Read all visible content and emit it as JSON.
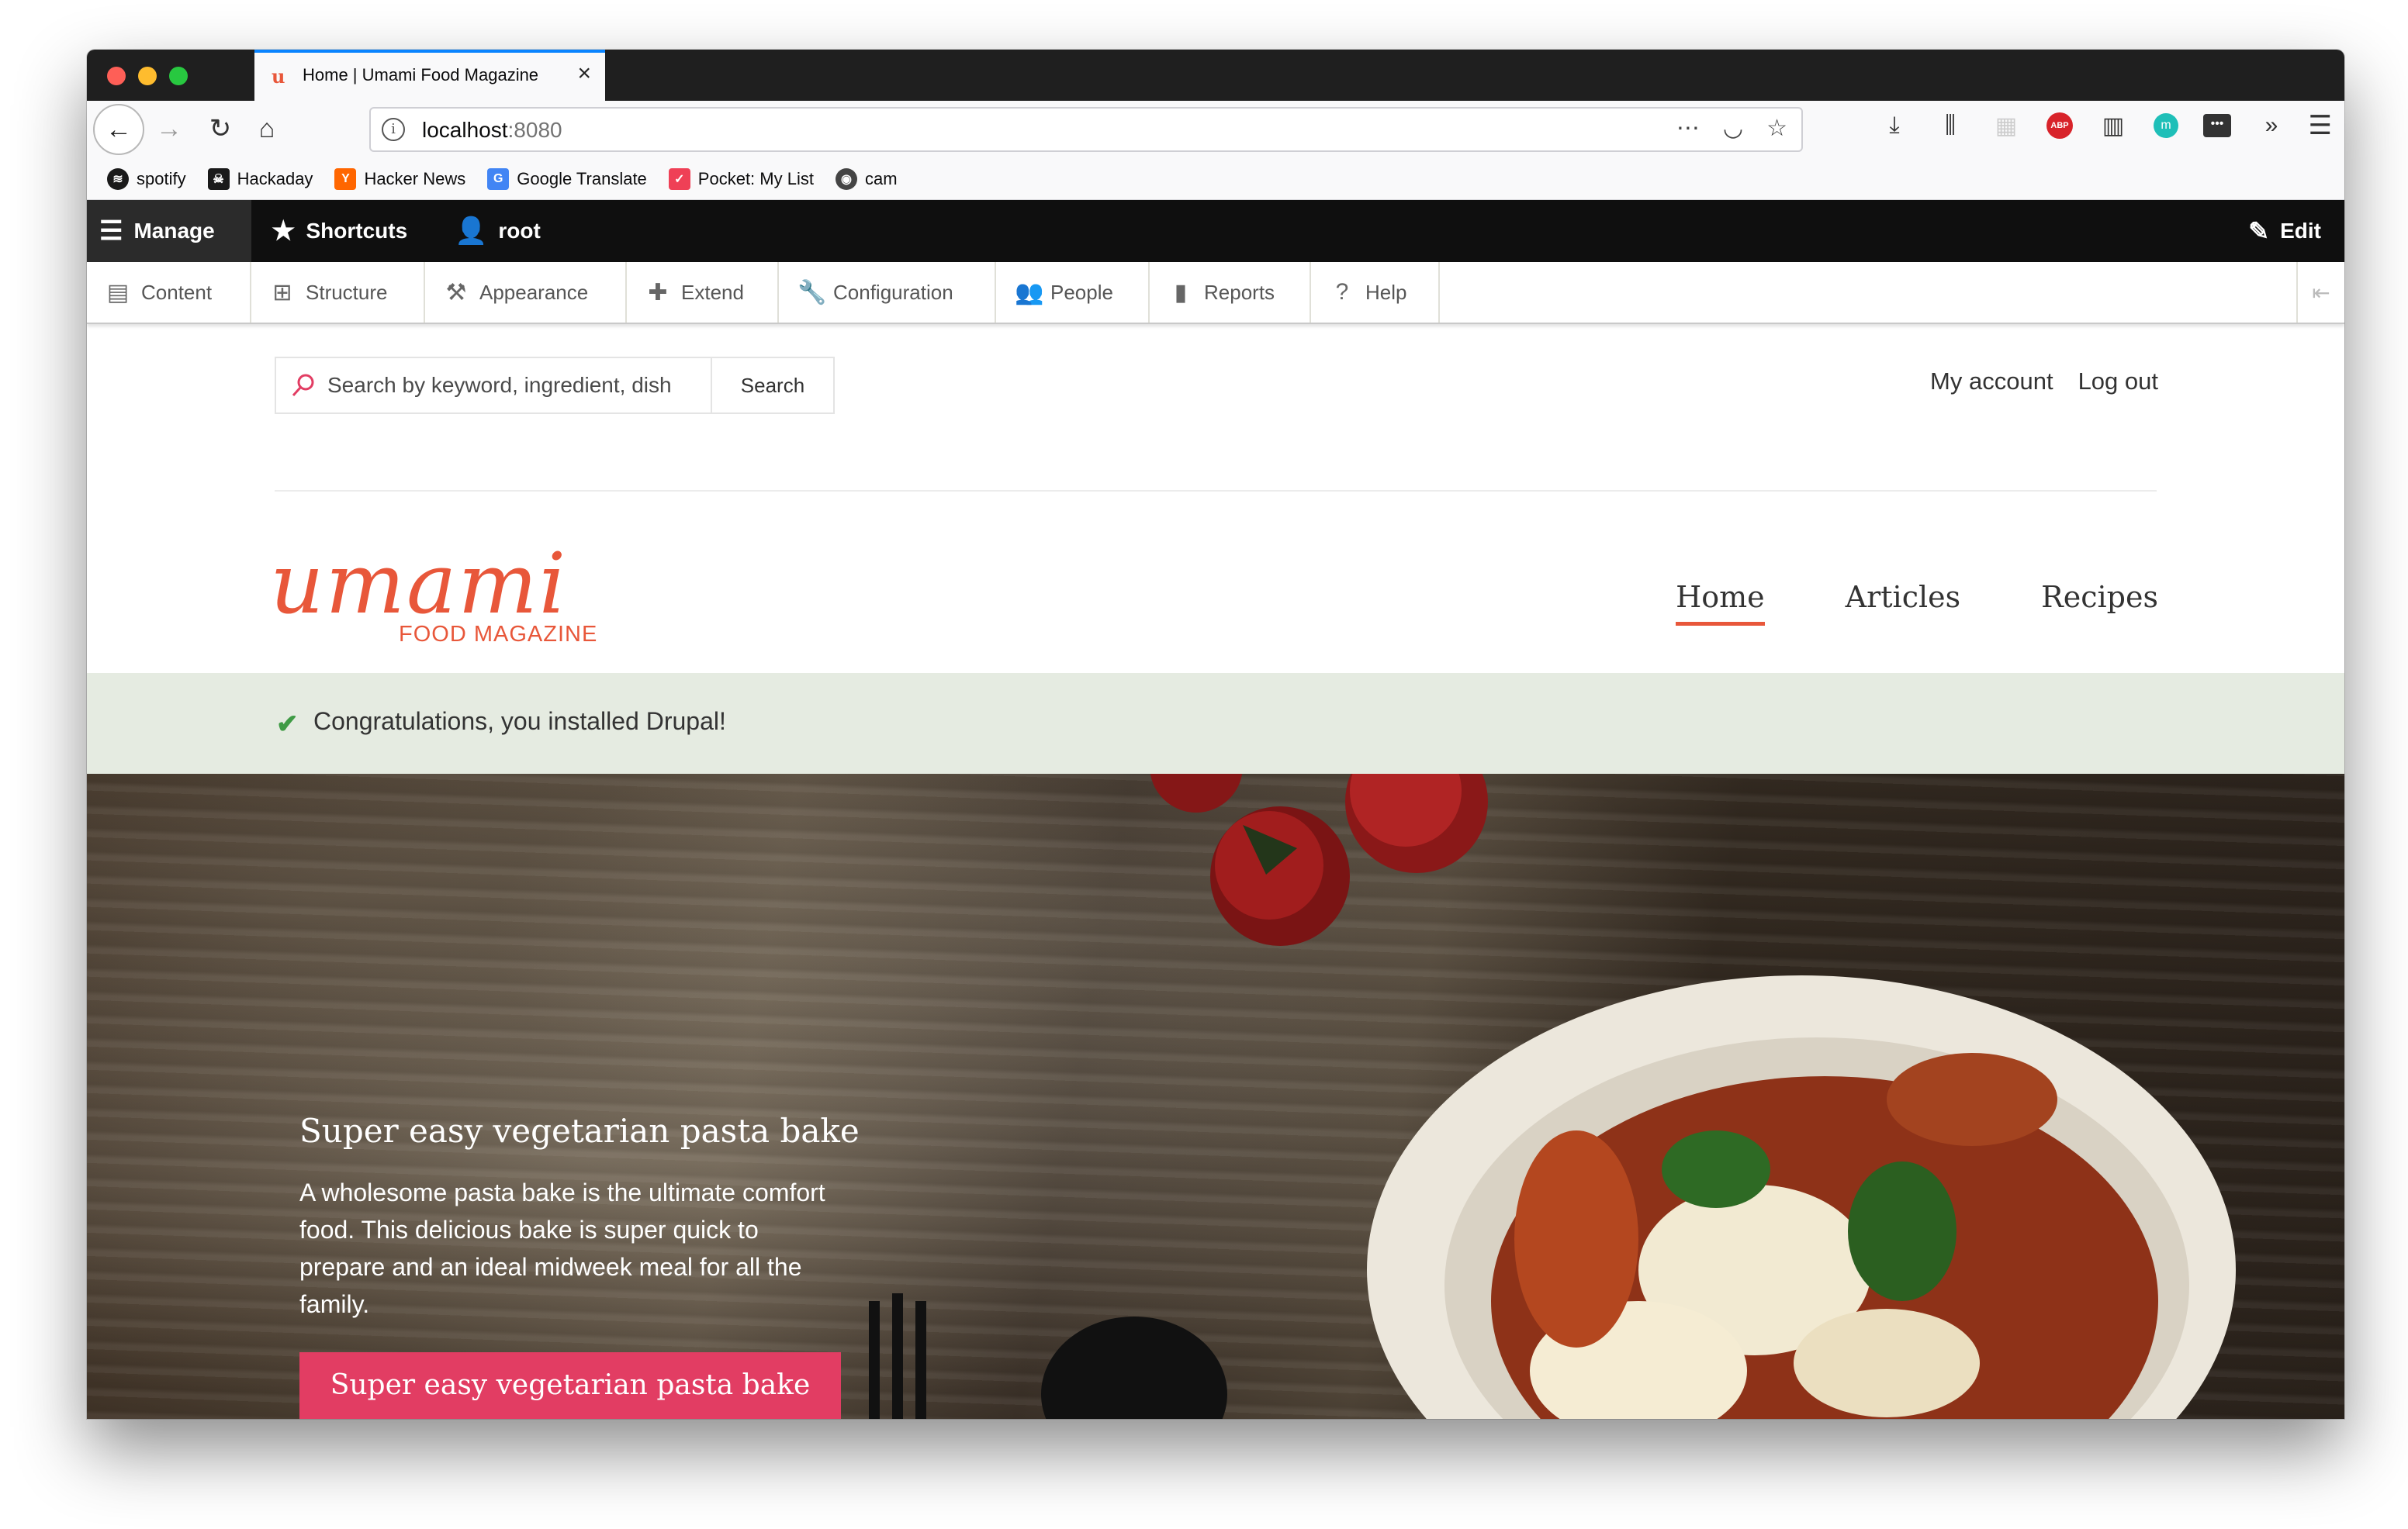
{
  "browser": {
    "tab_title": "Home | Umami Food Magazine",
    "tab_favicon": "umami-favicon",
    "url_host": "localhost",
    "url_port": ":8080",
    "bookmarks": [
      {
        "label": "spotify",
        "icon": "spotify-icon",
        "color": "#1a1a1a"
      },
      {
        "label": "Hackaday",
        "icon": "hackaday-icon",
        "color": "#1a1a1a"
      },
      {
        "label": "Hacker News",
        "icon": "hacker-news-icon",
        "color": "#ff6600"
      },
      {
        "label": "Google Translate",
        "icon": "google-translate-icon",
        "color": "#4285f4"
      },
      {
        "label": "Pocket: My List",
        "icon": "pocket-icon",
        "color": "#ef4056"
      },
      {
        "label": "cam",
        "icon": "cam-icon",
        "color": "#444444"
      }
    ]
  },
  "admin_toolbar": {
    "manage": "Manage",
    "shortcuts": "Shortcuts",
    "user": "root",
    "edit": "Edit"
  },
  "admin_tray": [
    {
      "label": "Content",
      "icon": "content-icon"
    },
    {
      "label": "Structure",
      "icon": "structure-icon"
    },
    {
      "label": "Appearance",
      "icon": "appearance-icon"
    },
    {
      "label": "Extend",
      "icon": "extend-icon"
    },
    {
      "label": "Configuration",
      "icon": "configuration-icon"
    },
    {
      "label": "People",
      "icon": "people-icon"
    },
    {
      "label": "Reports",
      "icon": "reports-icon"
    },
    {
      "label": "Help",
      "icon": "help-icon"
    }
  ],
  "site": {
    "search_placeholder": "Search by keyword, ingredient, dish",
    "search_button": "Search",
    "my_account": "My account",
    "log_out": "Log out",
    "logo_word": "umami",
    "logo_sub": "FOOD MAGAZINE",
    "nav": [
      {
        "label": "Home",
        "active": true
      },
      {
        "label": "Articles",
        "active": false
      },
      {
        "label": "Recipes",
        "active": false
      }
    ],
    "status_message": "Congratulations, you installed Drupal!",
    "hero": {
      "title": "Super easy vegetarian pasta bake",
      "description": "A wholesome pasta bake is the ultimate comfort food. This delicious bake is super quick to prepare and an ideal midweek meal for all the family.",
      "cta": "Super easy vegetarian pasta bake"
    }
  },
  "colors": {
    "brand": "#e8573a",
    "cta": "#e23d63",
    "status_bg": "#e5ebe1",
    "status_check": "#3f9b45",
    "admin_toolbar_bg": "#0f0f0f"
  }
}
